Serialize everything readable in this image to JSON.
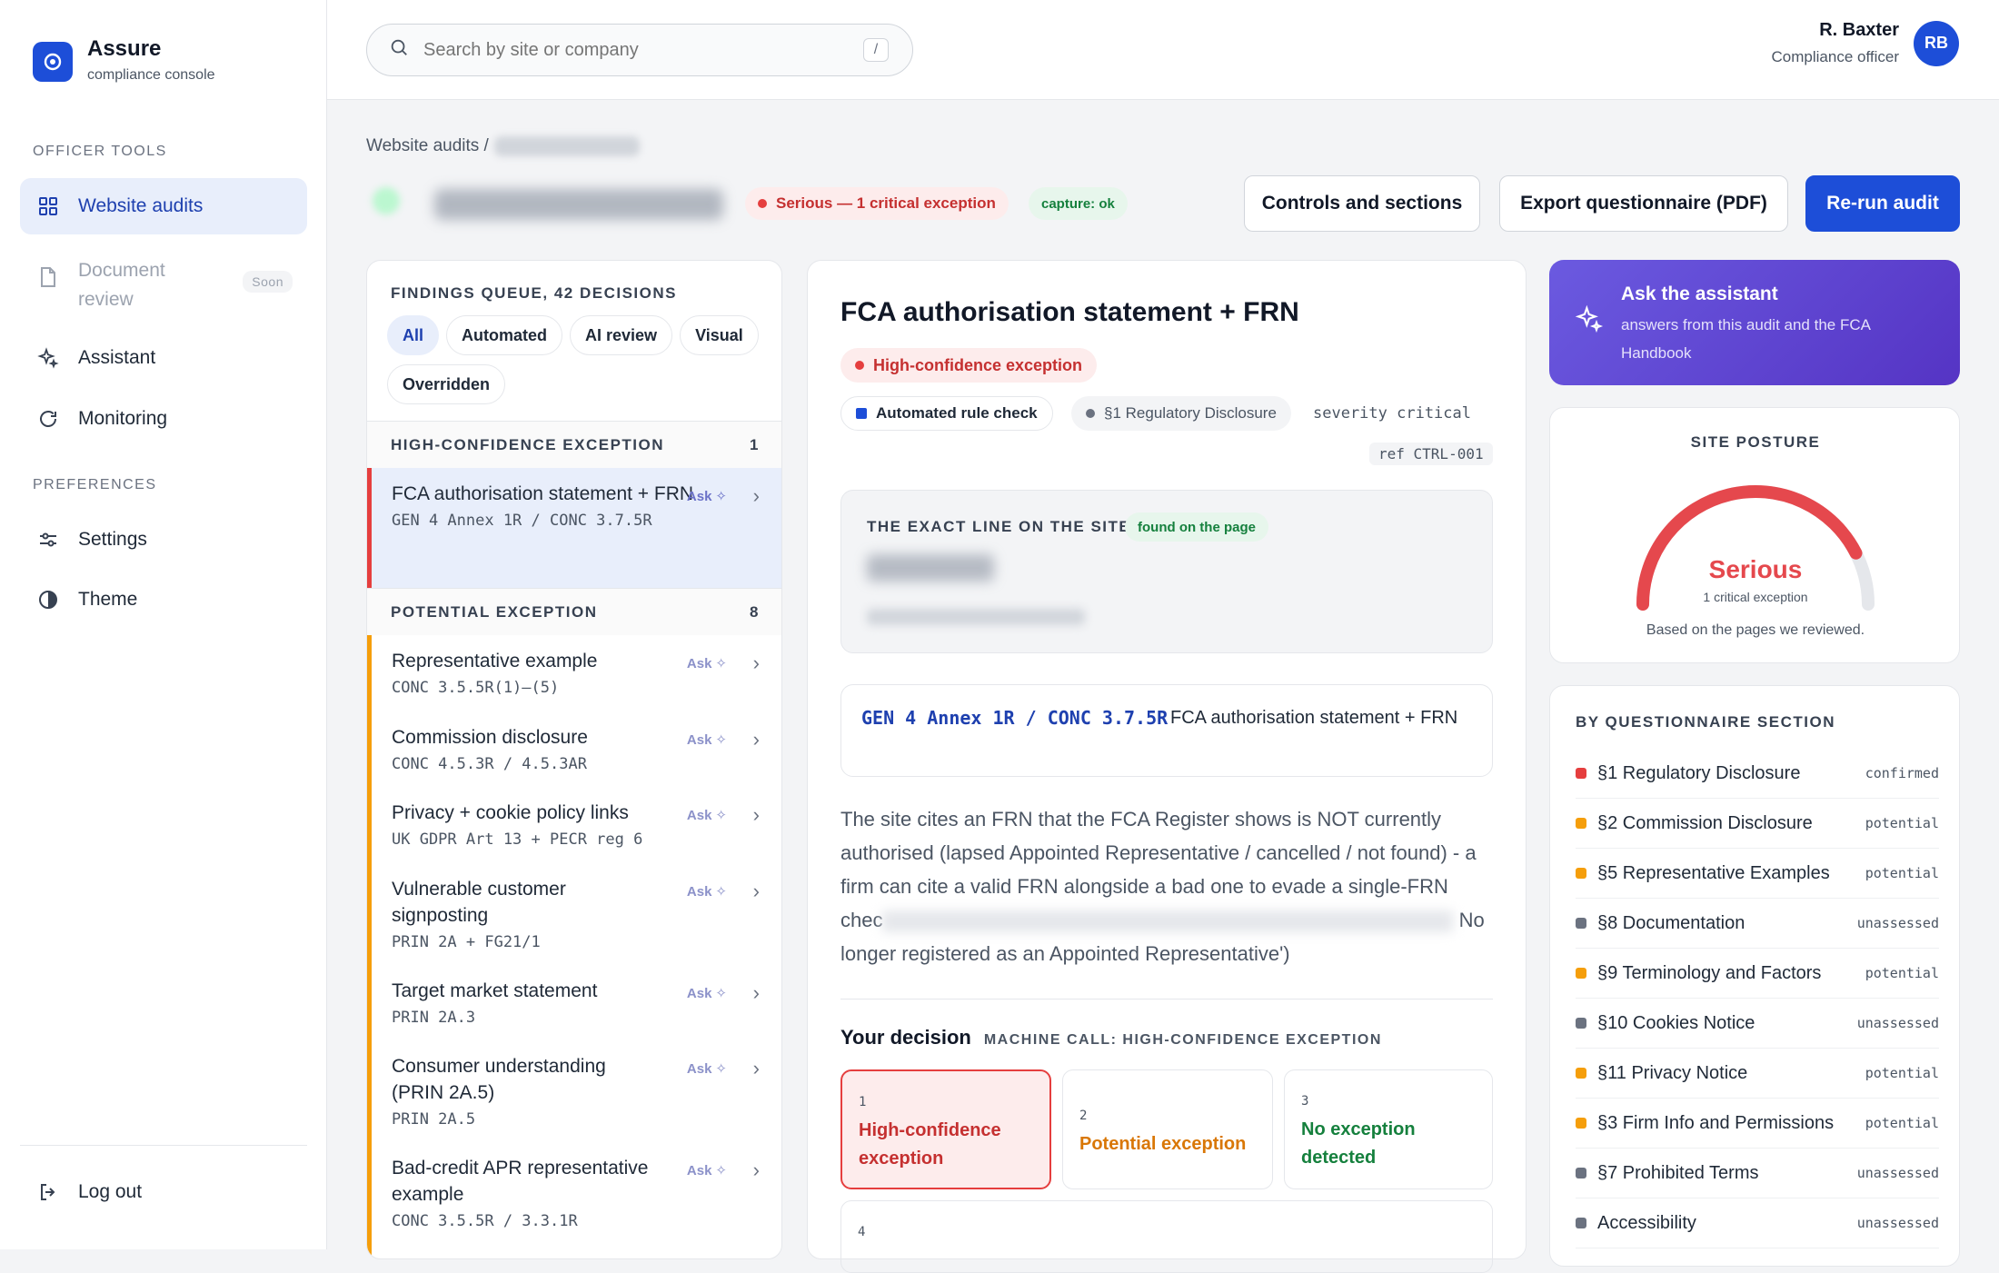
{
  "brand": {
    "title": "Assure",
    "subtitle": "compliance console"
  },
  "sidebar": {
    "tools_heading": "OFFICER TOOLS",
    "prefs_heading": "PREFERENCES",
    "items": [
      {
        "label": "Website audits"
      },
      {
        "label": "Document review",
        "badge": "Soon"
      },
      {
        "label": "Assistant"
      },
      {
        "label": "Monitoring"
      },
      {
        "label": "Settings"
      },
      {
        "label": "Theme"
      }
    ],
    "logout": "Log out"
  },
  "search": {
    "placeholder": "Search by site or company",
    "shortcut": "/"
  },
  "user": {
    "name": "R. Baxter",
    "role": "Compliance officer",
    "initials": "RB"
  },
  "breadcrumb": {
    "root": "Website audits /"
  },
  "header": {
    "severity": "Serious — 1 critical exception",
    "capture": "capture: ok",
    "buttons": {
      "controls": "Controls and sections",
      "export": "Export questionnaire (PDF)",
      "rerun": "Re-run audit"
    }
  },
  "queue": {
    "title": "FINDINGS QUEUE, 42 DECISIONS",
    "filters": [
      "All",
      "Automated",
      "AI review",
      "Visual",
      "Overridden"
    ],
    "groups": [
      {
        "label": "HIGH-CONFIDENCE EXCEPTION",
        "count": "1"
      },
      {
        "label": "POTENTIAL EXCEPTION",
        "count": "8"
      }
    ],
    "ask_label": "Ask",
    "items": [
      {
        "title": "FCA authorisation statement + FRN",
        "ref": "GEN 4 Annex 1R / CONC 3.7.5R"
      },
      {
        "title": "Representative example",
        "ref": "CONC 3.5.5R(1)–(5)"
      },
      {
        "title": "Commission disclosure",
        "ref": "CONC 4.5.3R / 4.5.3AR"
      },
      {
        "title": "Privacy + cookie policy links",
        "ref": "UK GDPR Art 13 + PECR reg 6"
      },
      {
        "title": "Vulnerable customer signposting",
        "ref": "PRIN 2A + FG21/1"
      },
      {
        "title": "Target market statement",
        "ref": "PRIN 2A.3"
      },
      {
        "title": "Consumer understanding (PRIN 2A.5)",
        "ref": "PRIN 2A.5"
      },
      {
        "title": "Bad-credit APR representative example",
        "ref": "CONC 3.5.5R / 3.3.1R"
      }
    ]
  },
  "detail": {
    "title": "FCA authorisation statement + FRN",
    "confidence": "High-confidence exception",
    "check_type": "Automated rule check",
    "section": "§1 Regulatory Disclosure",
    "severity": "severity critical",
    "ref": "ref CTRL-001",
    "exact_label": "THE EXACT LINE ON THE SITE",
    "found": "found on the page",
    "rule_code": "GEN 4 Annex 1R / CONC 3.7.5R",
    "rule_text": "FCA authorisation statement + FRN",
    "description_a": "The site cites an FRN that the FCA Register shows is NOT currently authorised (lapsed Appointed Representative / cancelled / not found) - a firm can cite a valid FRN alongside a bad one to evade a single-FRN chec",
    "description_b": "No longer registered as an Appointed Representative')",
    "decision_label": "Your decision",
    "machine_call": "MACHINE CALL: HIGH-CONFIDENCE EXCEPTION",
    "options": [
      {
        "num": "1",
        "label": "High-confidence exception"
      },
      {
        "num": "2",
        "label": "Potential exception"
      },
      {
        "num": "3",
        "label": "No exception detected"
      },
      {
        "num": "4",
        "label": ""
      }
    ]
  },
  "assistant": {
    "title": "Ask the assistant",
    "subtitle": "answers from this audit and the FCA Handbook"
  },
  "posture": {
    "title": "SITE POSTURE",
    "level": "Serious",
    "detail": "1 critical exception",
    "note": "Based on the pages we reviewed.",
    "gauge_fraction": 0.85
  },
  "sections": {
    "title": "BY QUESTIONNAIRE SECTION",
    "rows": [
      {
        "name": "§1 Regulatory Disclosure",
        "status": "confirmed",
        "color": "#e53e3e"
      },
      {
        "name": "§2 Commission Disclosure",
        "status": "potential",
        "color": "#f59e0b"
      },
      {
        "name": "§5 Representative Examples",
        "status": "potential",
        "color": "#f59e0b"
      },
      {
        "name": "§8 Documentation",
        "status": "unassessed",
        "color": "#6b7280"
      },
      {
        "name": "§9 Terminology and Factors",
        "status": "potential",
        "color": "#f59e0b"
      },
      {
        "name": "§10 Cookies Notice",
        "status": "unassessed",
        "color": "#6b7280"
      },
      {
        "name": "§11 Privacy Notice",
        "status": "potential",
        "color": "#f59e0b"
      },
      {
        "name": "§3 Firm Info and Permissions",
        "status": "potential",
        "color": "#f59e0b"
      },
      {
        "name": "§7 Prohibited Terms",
        "status": "unassessed",
        "color": "#6b7280"
      },
      {
        "name": "Accessibility",
        "status": "unassessed",
        "color": "#6b7280"
      }
    ]
  }
}
